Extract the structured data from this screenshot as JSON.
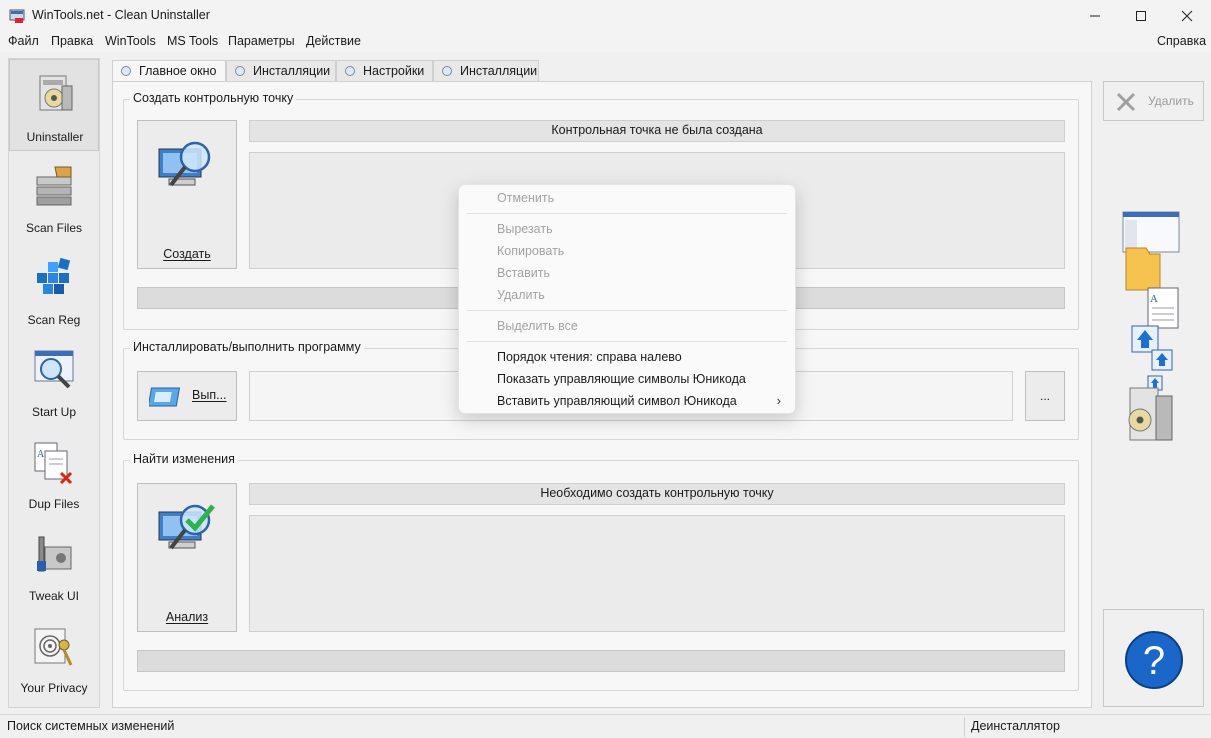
{
  "window": {
    "title": "WinTools.net - Clean Uninstaller"
  },
  "menu": {
    "items": [
      "Файл",
      "Правка",
      "WinTools",
      "MS Tools",
      "Параметры",
      "Действие"
    ],
    "help": "Справка"
  },
  "sidebar": {
    "items": [
      {
        "label": "Uninstaller",
        "icon": "uninstaller-icon"
      },
      {
        "label": "Scan Files",
        "icon": "scan-files-icon"
      },
      {
        "label": "Scan Reg",
        "icon": "scan-reg-icon"
      },
      {
        "label": "Start Up",
        "icon": "start-up-icon"
      },
      {
        "label": "Dup Files",
        "icon": "dup-files-icon"
      },
      {
        "label": "Tweak UI",
        "icon": "tweak-ui-icon"
      },
      {
        "label": "Your Privacy",
        "icon": "privacy-icon"
      }
    ]
  },
  "tabs": [
    "Главное окно",
    "Инсталляции",
    "Настройки",
    "Инсталляции"
  ],
  "groups": {
    "checkpoint": {
      "title": "Создать контрольную точку",
      "button": "Создать",
      "status": "Контрольная точка не была создана"
    },
    "install": {
      "title": "Инсталлировать/выполнить программу",
      "button": "Вып...",
      "browse": "..."
    },
    "changes": {
      "title": "Найти изменения",
      "button": "Анализ",
      "status": "Необходимо создать контрольную точку"
    }
  },
  "right": {
    "delete_label": "Удалить",
    "help_glyph": "?"
  },
  "statusbar": {
    "left": "Поиск системных изменений",
    "right": "Деинсталлятор"
  },
  "context_menu": {
    "undo": "Отменить",
    "cut": "Вырезать",
    "copy": "Копировать",
    "paste": "Вставить",
    "delete": "Удалить",
    "select_all": "Выделить все",
    "rtl": "Порядок чтения: справа налево",
    "show_unicode": "Показать управляющие символы Юникода",
    "insert_unicode": "Вставить управляющий символ Юникода"
  },
  "colors": {
    "accent": "#1f6fd1",
    "check": "#2fb24a",
    "help_blue": "#1a66c9"
  }
}
